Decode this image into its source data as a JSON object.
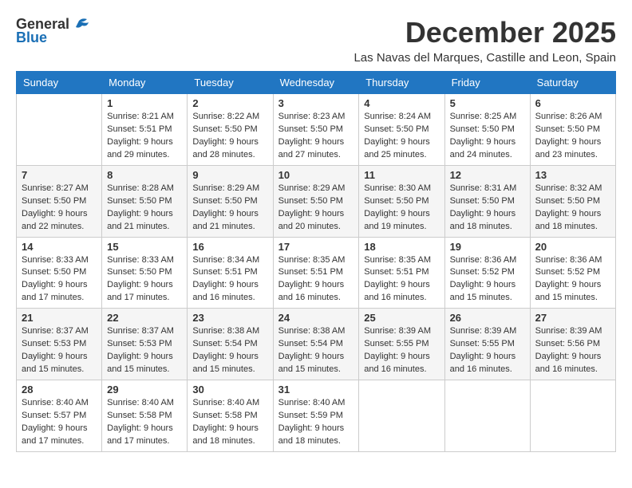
{
  "logo": {
    "general": "General",
    "blue": "Blue"
  },
  "title": "December 2025",
  "location": "Las Navas del Marques, Castille and Leon, Spain",
  "days_of_week": [
    "Sunday",
    "Monday",
    "Tuesday",
    "Wednesday",
    "Thursday",
    "Friday",
    "Saturday"
  ],
  "weeks": [
    [
      {
        "day": "",
        "info": ""
      },
      {
        "day": "1",
        "info": "Sunrise: 8:21 AM\nSunset: 5:51 PM\nDaylight: 9 hours\nand 29 minutes."
      },
      {
        "day": "2",
        "info": "Sunrise: 8:22 AM\nSunset: 5:50 PM\nDaylight: 9 hours\nand 28 minutes."
      },
      {
        "day": "3",
        "info": "Sunrise: 8:23 AM\nSunset: 5:50 PM\nDaylight: 9 hours\nand 27 minutes."
      },
      {
        "day": "4",
        "info": "Sunrise: 8:24 AM\nSunset: 5:50 PM\nDaylight: 9 hours\nand 25 minutes."
      },
      {
        "day": "5",
        "info": "Sunrise: 8:25 AM\nSunset: 5:50 PM\nDaylight: 9 hours\nand 24 minutes."
      },
      {
        "day": "6",
        "info": "Sunrise: 8:26 AM\nSunset: 5:50 PM\nDaylight: 9 hours\nand 23 minutes."
      }
    ],
    [
      {
        "day": "7",
        "info": "Sunrise: 8:27 AM\nSunset: 5:50 PM\nDaylight: 9 hours\nand 22 minutes."
      },
      {
        "day": "8",
        "info": "Sunrise: 8:28 AM\nSunset: 5:50 PM\nDaylight: 9 hours\nand 21 minutes."
      },
      {
        "day": "9",
        "info": "Sunrise: 8:29 AM\nSunset: 5:50 PM\nDaylight: 9 hours\nand 21 minutes."
      },
      {
        "day": "10",
        "info": "Sunrise: 8:29 AM\nSunset: 5:50 PM\nDaylight: 9 hours\nand 20 minutes."
      },
      {
        "day": "11",
        "info": "Sunrise: 8:30 AM\nSunset: 5:50 PM\nDaylight: 9 hours\nand 19 minutes."
      },
      {
        "day": "12",
        "info": "Sunrise: 8:31 AM\nSunset: 5:50 PM\nDaylight: 9 hours\nand 18 minutes."
      },
      {
        "day": "13",
        "info": "Sunrise: 8:32 AM\nSunset: 5:50 PM\nDaylight: 9 hours\nand 18 minutes."
      }
    ],
    [
      {
        "day": "14",
        "info": "Sunrise: 8:33 AM\nSunset: 5:50 PM\nDaylight: 9 hours\nand 17 minutes."
      },
      {
        "day": "15",
        "info": "Sunrise: 8:33 AM\nSunset: 5:50 PM\nDaylight: 9 hours\nand 17 minutes."
      },
      {
        "day": "16",
        "info": "Sunrise: 8:34 AM\nSunset: 5:51 PM\nDaylight: 9 hours\nand 16 minutes."
      },
      {
        "day": "17",
        "info": "Sunrise: 8:35 AM\nSunset: 5:51 PM\nDaylight: 9 hours\nand 16 minutes."
      },
      {
        "day": "18",
        "info": "Sunrise: 8:35 AM\nSunset: 5:51 PM\nDaylight: 9 hours\nand 16 minutes."
      },
      {
        "day": "19",
        "info": "Sunrise: 8:36 AM\nSunset: 5:52 PM\nDaylight: 9 hours\nand 15 minutes."
      },
      {
        "day": "20",
        "info": "Sunrise: 8:36 AM\nSunset: 5:52 PM\nDaylight: 9 hours\nand 15 minutes."
      }
    ],
    [
      {
        "day": "21",
        "info": "Sunrise: 8:37 AM\nSunset: 5:53 PM\nDaylight: 9 hours\nand 15 minutes."
      },
      {
        "day": "22",
        "info": "Sunrise: 8:37 AM\nSunset: 5:53 PM\nDaylight: 9 hours\nand 15 minutes."
      },
      {
        "day": "23",
        "info": "Sunrise: 8:38 AM\nSunset: 5:54 PM\nDaylight: 9 hours\nand 15 minutes."
      },
      {
        "day": "24",
        "info": "Sunrise: 8:38 AM\nSunset: 5:54 PM\nDaylight: 9 hours\nand 15 minutes."
      },
      {
        "day": "25",
        "info": "Sunrise: 8:39 AM\nSunset: 5:55 PM\nDaylight: 9 hours\nand 16 minutes."
      },
      {
        "day": "26",
        "info": "Sunrise: 8:39 AM\nSunset: 5:55 PM\nDaylight: 9 hours\nand 16 minutes."
      },
      {
        "day": "27",
        "info": "Sunrise: 8:39 AM\nSunset: 5:56 PM\nDaylight: 9 hours\nand 16 minutes."
      }
    ],
    [
      {
        "day": "28",
        "info": "Sunrise: 8:40 AM\nSunset: 5:57 PM\nDaylight: 9 hours\nand 17 minutes."
      },
      {
        "day": "29",
        "info": "Sunrise: 8:40 AM\nSunset: 5:58 PM\nDaylight: 9 hours\nand 17 minutes."
      },
      {
        "day": "30",
        "info": "Sunrise: 8:40 AM\nSunset: 5:58 PM\nDaylight: 9 hours\nand 18 minutes."
      },
      {
        "day": "31",
        "info": "Sunrise: 8:40 AM\nSunset: 5:59 PM\nDaylight: 9 hours\nand 18 minutes."
      },
      {
        "day": "",
        "info": ""
      },
      {
        "day": "",
        "info": ""
      },
      {
        "day": "",
        "info": ""
      }
    ]
  ]
}
